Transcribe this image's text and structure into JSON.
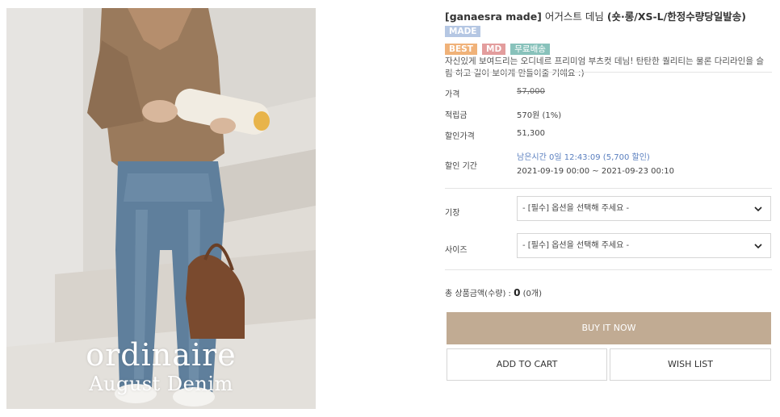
{
  "photo": {
    "caption_line1": "ordinaire",
    "caption_line2": "August Denim"
  },
  "product": {
    "title_brand": "[ganaesra made]",
    "title_name": " 어거스트 데님 ",
    "title_option": "(숏·롱/XS-L/",
    "title_rest": "한정수량당일발송)",
    "badges": {
      "made": "MADE",
      "best": "BEST",
      "md": "MD",
      "free_shipping": "무료배송"
    },
    "description": "자신있게 보여드리는 오디네르 프리미엄 부츠컷 데님! 탄탄한 퀄리티는 물론 다리라인을 슬림 하고 길어 보이게 만들어줄 거에요 :)"
  },
  "details": {
    "price_label": "가격",
    "price_value": "57,000",
    "points_label": "적립금",
    "points_value": "570원 (1%)",
    "sale_price_label": "할인가격",
    "sale_price_value": "51,300",
    "sale_period_label": "할인 기간",
    "time_left": "남은시간 0일 12:43:09 (5,700 할인)",
    "period_range": "2021-09-19 00:00 ~ 2021-09-23 00:10"
  },
  "options": {
    "length_label": "기장",
    "length_placeholder": "- [필수] 옵션을 선택해 주세요 -",
    "size_label": "사이즈",
    "size_placeholder": "- [필수] 옵션을 선택해 주세요 -"
  },
  "total": {
    "label": "총 상품금액(수량) : ",
    "amount": "0",
    "qty": " (0개)"
  },
  "buttons": {
    "buy_now": "BUY IT NOW",
    "add_to_cart": "ADD TO CART",
    "wish_list": "WISH LIST"
  },
  "colors": {
    "buy_button": "#c1ab93",
    "badge_made": "#b5c7e3",
    "badge_best": "#f0b279",
    "badge_md": "#e39d9d",
    "badge_free": "#88c2bb",
    "link_blue": "#5a7fbf"
  }
}
